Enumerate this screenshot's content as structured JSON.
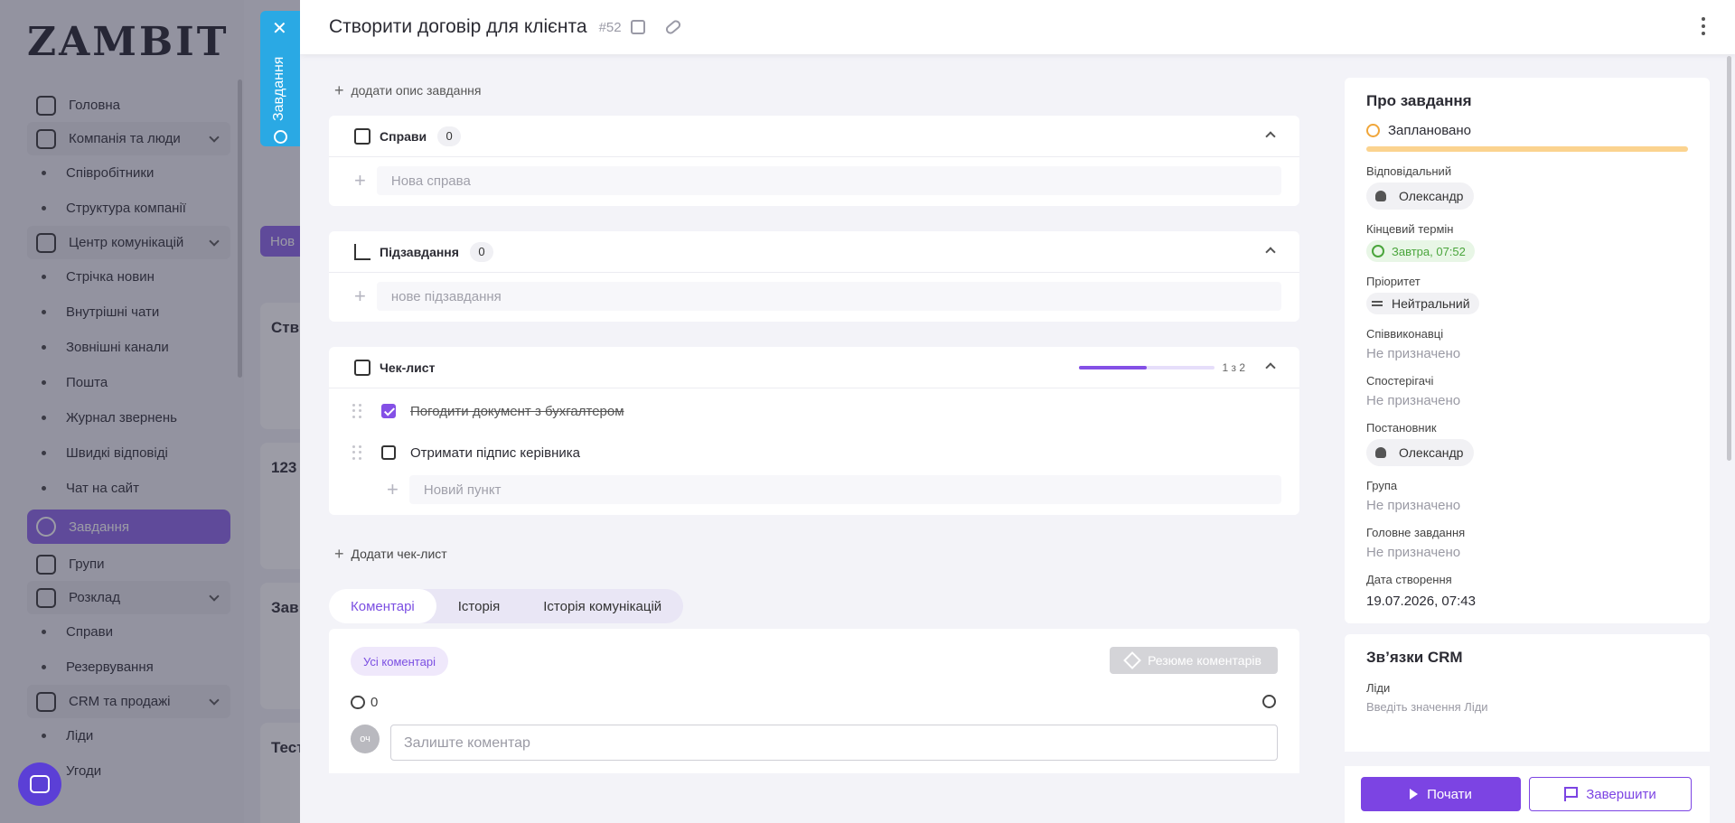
{
  "app": {
    "logo": "ZAMBIT",
    "nav": [
      {
        "label": "Головна",
        "type": "item"
      },
      {
        "label": "Компанія та люди",
        "type": "group"
      },
      {
        "label": "Співробітники",
        "type": "sub"
      },
      {
        "label": "Структура компанії",
        "type": "sub"
      },
      {
        "label": "Центр комунікацій",
        "type": "group"
      },
      {
        "label": "Стрічка новин",
        "type": "sub"
      },
      {
        "label": "Внутрішні чати",
        "type": "sub"
      },
      {
        "label": "Зовнішні канали",
        "type": "sub"
      },
      {
        "label": "Пошта",
        "type": "sub"
      },
      {
        "label": "Журнал звернень",
        "type": "sub"
      },
      {
        "label": "Швидкі відповіді",
        "type": "sub"
      },
      {
        "label": "Чат на сайт",
        "type": "sub"
      },
      {
        "label": "Завдання",
        "type": "active"
      },
      {
        "label": "Групи",
        "type": "item"
      },
      {
        "label": "Розклад",
        "type": "group"
      },
      {
        "label": "Справи",
        "type": "sub"
      },
      {
        "label": "Резервування",
        "type": "sub"
      },
      {
        "label": "CRM та продажі",
        "type": "group"
      },
      {
        "label": "Ліди",
        "type": "sub"
      },
      {
        "label": "Угоди",
        "type": "sub"
      }
    ],
    "bg": {
      "new_button": "Нов",
      "cards": [
        "Ств",
        "123",
        "Зав",
        "Тест"
      ]
    }
  },
  "side_tab": {
    "label": "Завдання"
  },
  "panel": {
    "title": "Створити договір для клієнта",
    "task_number": "#52",
    "add_description": "додати опис завдання",
    "sections": {
      "affairs": {
        "title": "Справи",
        "count": "0",
        "new_placeholder": "Нова справа"
      },
      "subtasks": {
        "title": "Підзавдання",
        "count": "0",
        "new_placeholder": "нове підзавдання"
      },
      "checklist": {
        "title": "Чек-лист",
        "progress_text": "1 з 2",
        "progress": 0.5,
        "items": [
          {
            "text": "Погодити документ з бухгалтером",
            "done": true
          },
          {
            "text": "Отримати підпис керівника",
            "done": false
          }
        ],
        "new_placeholder": "Новий пункт"
      }
    },
    "add_checklist": "Додати чек-лист",
    "tabs": [
      "Коментарі",
      "Історія",
      "Історія комунікацій"
    ],
    "active_tab": 0,
    "comments": {
      "filter": "Усі коментарі",
      "summary_button": "Резюме коментарів",
      "count": "0",
      "avatar_initials": "оч",
      "input_placeholder": "Залиште коментар"
    }
  },
  "about": {
    "title": "Про завдання",
    "status": "Заплановано",
    "status_color": "#f0a63a",
    "responsible_label": "Відповідальний",
    "responsible": "Олександр",
    "deadline_label": "Кінцевий термін",
    "deadline": "Завтра, 07:52",
    "priority_label": "Пріоритет",
    "priority": "Нейтральний",
    "coexecutors_label": "Співвиконавці",
    "coexecutors": "Не призначено",
    "observers_label": "Спостерігачі",
    "observers": "Не призначено",
    "author_label": "Постановник",
    "author": "Олександр",
    "group_label": "Група",
    "group": "Не призначено",
    "parent_label": "Головне завдання",
    "parent": "Не призначено",
    "created_label": "Дата створення",
    "created": "19.07.2026, 07:43"
  },
  "crm": {
    "title": "Зв’язки CRM",
    "leads_label": "Ліди",
    "leads_placeholder": "Введіть значення Ліди"
  },
  "footer": {
    "start": "Почати",
    "finish": "Завершити"
  },
  "colors": {
    "accent": "#7c44e3",
    "side_tab": "#2aa9e4"
  }
}
